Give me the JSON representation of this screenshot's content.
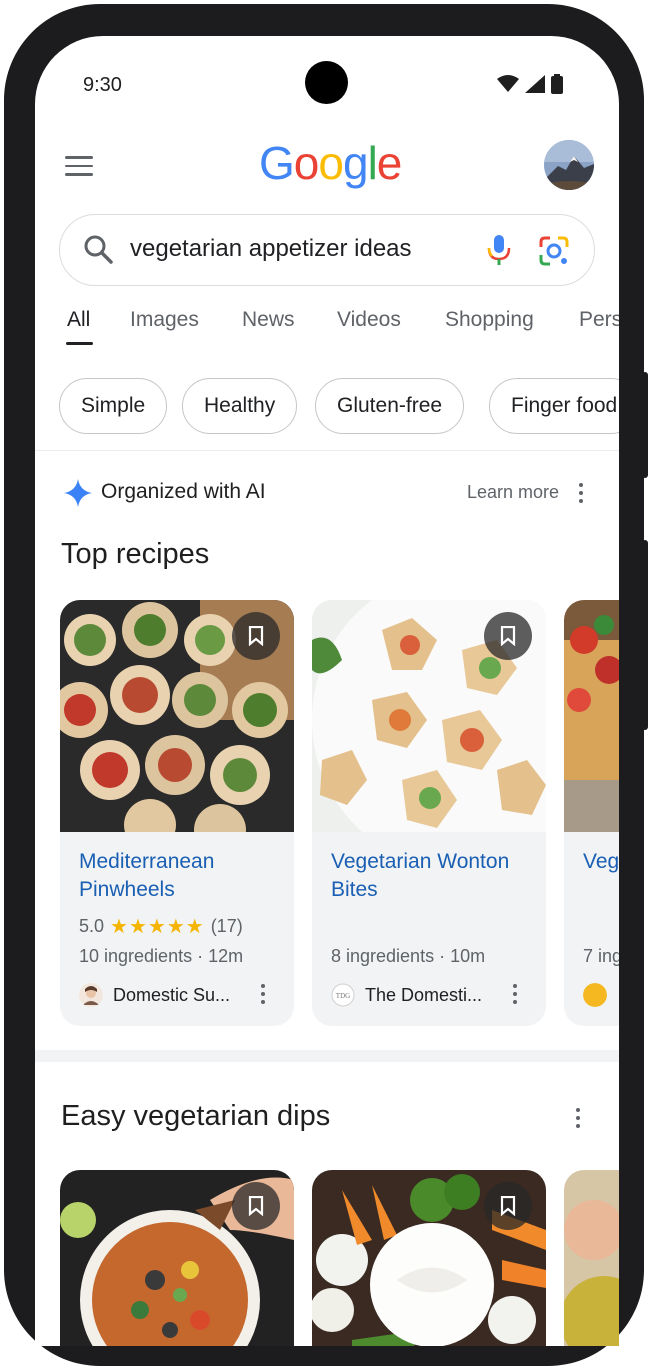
{
  "status_bar": {
    "time": "9:30"
  },
  "header": {
    "logo_letters": [
      "G",
      "o",
      "o",
      "g",
      "l",
      "e"
    ],
    "logo_colors": [
      "#4285F4",
      "#EA4335",
      "#FBBC05",
      "#4285F4",
      "#34A853",
      "#EA4335"
    ]
  },
  "search": {
    "query": "vegetarian appetizer ideas"
  },
  "tabs": [
    "All",
    "Images",
    "News",
    "Videos",
    "Shopping",
    "Pers"
  ],
  "active_tab": "All",
  "chips": [
    "Simple",
    "Healthy",
    "Gluten-free",
    "Finger food"
  ],
  "ai_banner": {
    "label": "Organized with AI",
    "learn_more": "Learn more"
  },
  "top_recipes": {
    "title": "Top recipes",
    "cards": [
      {
        "title": "Mediterranean Pinwheels",
        "rating": "5.0",
        "stars": "★★★★★",
        "reviews": "(17)",
        "meta": "10 ingredients · 12m",
        "source": "Domestic Su..."
      },
      {
        "title": "Vegetarian Wonton Bites",
        "meta": "8 ingredients · 10m",
        "source": "The Domesti..."
      },
      {
        "title": "Veg",
        "meta": "7 ing",
        "source": ""
      }
    ]
  },
  "dips": {
    "title": "Easy vegetarian dips"
  },
  "colors": {
    "accent_link": "#1a5fb4",
    "star": "#f4b400"
  }
}
